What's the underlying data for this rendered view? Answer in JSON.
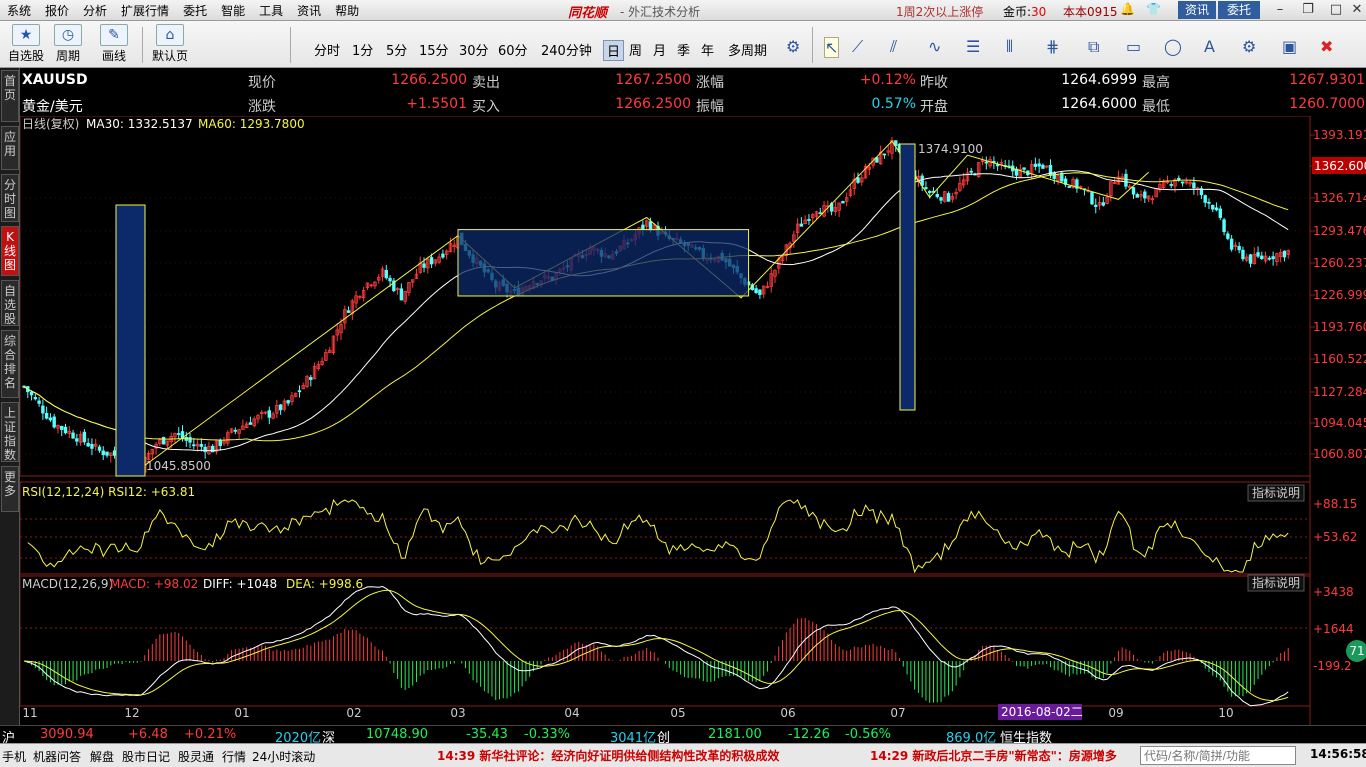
{
  "menu": [
    "系统",
    "报价",
    "分析",
    "扩展行情",
    "委托",
    "智能",
    "工具",
    "资讯",
    "帮助"
  ],
  "brand": "同花顺",
  "app_title": "- 外汇技术分析",
  "promo": "1周2次以上涨停",
  "coins_label": "金币:",
  "coins_value": "30",
  "user_version": "本本0915",
  "top_buttons": {
    "news": "资讯",
    "trade": "委托"
  },
  "toolbar": {
    "buttons": [
      "自选股",
      "周期",
      "画线",
      "默认页"
    ],
    "periods": [
      "分时",
      "1分",
      "5分",
      "15分",
      "30分",
      "60分",
      "240分钟",
      "日",
      "周",
      "月",
      "季",
      "年",
      "多周期"
    ],
    "active_period": "日"
  },
  "sidebar": [
    "首页",
    "应用",
    "分时图",
    "K线图",
    "自选股",
    "综合排名",
    "上证指数",
    "更多"
  ],
  "quote": {
    "symbol": "XAUUSD",
    "name": "黄金/美元",
    "row1": [
      {
        "label": "现价",
        "value": "1266.2500"
      },
      {
        "label": "卖出",
        "value": "1267.2500"
      },
      {
        "label": "涨幅",
        "value": "+0.12%"
      },
      {
        "label": "昨收",
        "value": "1264.6999"
      },
      {
        "label": "最高",
        "value": "1267.9301"
      }
    ],
    "row2": [
      {
        "label": "涨跌",
        "value": "+1.5501"
      },
      {
        "label": "买入",
        "value": "1266.2500"
      },
      {
        "label": "振幅",
        "value": "0.57%"
      },
      {
        "label": "开盘",
        "value": "1264.6000"
      },
      {
        "label": "最低",
        "value": "1260.7000"
      }
    ]
  },
  "main_legend": {
    "title": "日线(复权)",
    "ma30": "MA30: 1332.5137",
    "ma60": "MA60: 1293.7800"
  },
  "price_axis": [
    "1393.1911",
    "1362.6000",
    "1326.7141",
    "1293.4760",
    "1260.2379",
    "1226.9998",
    "1193.7600",
    "1160.5224",
    "1127.2840",
    "1094.0457",
    "1060.8071"
  ],
  "current_price_tag": "1362.6000",
  "annotations": {
    "high": "1374.9100",
    "low": "1045.8500"
  },
  "rsi": {
    "legend": "RSI(12,12,24) RSI12: +63.81",
    "axis": [
      "+88.15",
      "+53.62"
    ],
    "help": "指标说明"
  },
  "macd": {
    "legend_a": "MACD(12,26,9)",
    "legend_b": "MACD: +98.02",
    "legend_c": "DIFF: +1048",
    "legend_d": "DEA: +998.6",
    "axis": [
      "+3438",
      "+1644",
      "-199.2"
    ],
    "help": "指标说明",
    "side_badge": "71"
  },
  "x_axis": [
    "11",
    "12",
    "01",
    "02",
    "03",
    "04",
    "05",
    "06",
    "07",
    "09",
    "10"
  ],
  "cursor_date": "2016-08-02二",
  "index_bar": {
    "sh": {
      "label": "沪",
      "value": "3090.94",
      "change": "+6.48",
      "pct": "+0.21%",
      "vol": "2020亿"
    },
    "sz": {
      "label": "深",
      "value": "10748.90",
      "change": "-35.43",
      "pct": "-0.33%",
      "vol": "3041亿"
    },
    "cy": {
      "label": "创",
      "value": "2181.00",
      "change": "-12.26",
      "pct": "-0.56%",
      "vol": "869.0亿"
    },
    "hs": {
      "label": "恒生指数"
    }
  },
  "status": {
    "items": [
      "手机",
      "机器问答",
      "解盘",
      "股市日记",
      "股灵通",
      "行情",
      "24小时滚动"
    ],
    "ticker1": "14:39 新华社评论：经济向好证明供给侧结构性改革的积极成效",
    "ticker2": "14:29 新政后北京二手房\"新常态\"：房源增多",
    "code_placeholder": "代码/名称/简拼/功能",
    "time": "14:56:58"
  },
  "chart_data": {
    "type": "candlestick",
    "title": "日线(复权)",
    "series": [
      "XAUUSD",
      "MA30",
      "MA60"
    ],
    "y_range": [
      1045,
      1393
    ],
    "months": [
      "11",
      "12",
      "01",
      "02",
      "03",
      "04",
      "05",
      "06",
      "07",
      "09",
      "10"
    ],
    "close_path": [
      [
        0,
        1132
      ],
      [
        8,
        1095
      ],
      [
        15,
        1080
      ],
      [
        20,
        1068
      ],
      [
        25,
        1063
      ],
      [
        30,
        1048
      ],
      [
        35,
        1075
      ],
      [
        40,
        1085
      ],
      [
        45,
        1074
      ],
      [
        50,
        1070
      ],
      [
        55,
        1086
      ],
      [
        60,
        1098
      ],
      [
        65,
        1105
      ],
      [
        70,
        1115
      ],
      [
        75,
        1138
      ],
      [
        80,
        1165
      ],
      [
        85,
        1205
      ],
      [
        90,
        1232
      ],
      [
        95,
        1245
      ],
      [
        100,
        1222
      ],
      [
        105,
        1250
      ],
      [
        110,
        1262
      ],
      [
        115,
        1280
      ],
      [
        120,
        1255
      ],
      [
        125,
        1232
      ],
      [
        130,
        1225
      ],
      [
        135,
        1238
      ],
      [
        140,
        1240
      ],
      [
        145,
        1255
      ],
      [
        150,
        1270
      ],
      [
        155,
        1262
      ],
      [
        160,
        1275
      ],
      [
        165,
        1295
      ],
      [
        170,
        1280
      ],
      [
        175,
        1272
      ],
      [
        180,
        1262
      ],
      [
        185,
        1260
      ],
      [
        190,
        1240
      ],
      [
        195,
        1222
      ],
      [
        200,
        1255
      ],
      [
        205,
        1290
      ],
      [
        210,
        1310
      ],
      [
        215,
        1305
      ],
      [
        220,
        1335
      ],
      [
        225,
        1355
      ],
      [
        230,
        1372
      ],
      [
        235,
        1345
      ],
      [
        240,
        1325
      ],
      [
        245,
        1320
      ],
      [
        250,
        1340
      ],
      [
        255,
        1358
      ],
      [
        260,
        1348
      ],
      [
        265,
        1345
      ],
      [
        270,
        1352
      ],
      [
        275,
        1338
      ],
      [
        280,
        1330
      ],
      [
        285,
        1310
      ],
      [
        290,
        1345
      ],
      [
        295,
        1318
      ],
      [
        300,
        1325
      ],
      [
        305,
        1340
      ],
      [
        310,
        1330
      ],
      [
        315,
        1312
      ],
      [
        320,
        1270
      ],
      [
        325,
        1258
      ],
      [
        330,
        1262
      ],
      [
        335,
        1266
      ]
    ],
    "rsi12_last": 63.81,
    "macd_last": 98.02,
    "diff_last": 1048,
    "dea_last": 998.6
  }
}
